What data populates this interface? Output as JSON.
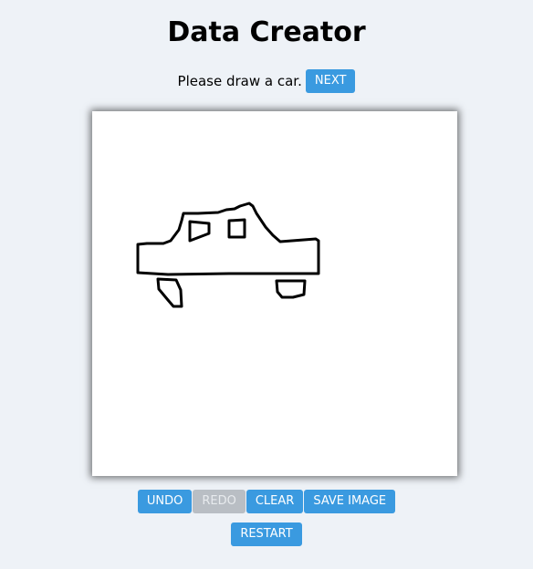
{
  "app": {
    "title": "Data Creator"
  },
  "prompt": {
    "text": "Please draw a car.",
    "next_label": "NEXT"
  },
  "canvas": {
    "drawing_subject": "car-sketch"
  },
  "toolbar": {
    "undo_label": "UNDO",
    "redo_label": "REDO",
    "clear_label": "CLEAR",
    "save_label": "SAVE IMAGE"
  },
  "footer": {
    "restart_label": "RESTART"
  },
  "colors": {
    "page_bg": "#eef2f7",
    "button": "#3a9ae0",
    "button_disabled": "#b9bec4",
    "stroke": "#000000"
  }
}
